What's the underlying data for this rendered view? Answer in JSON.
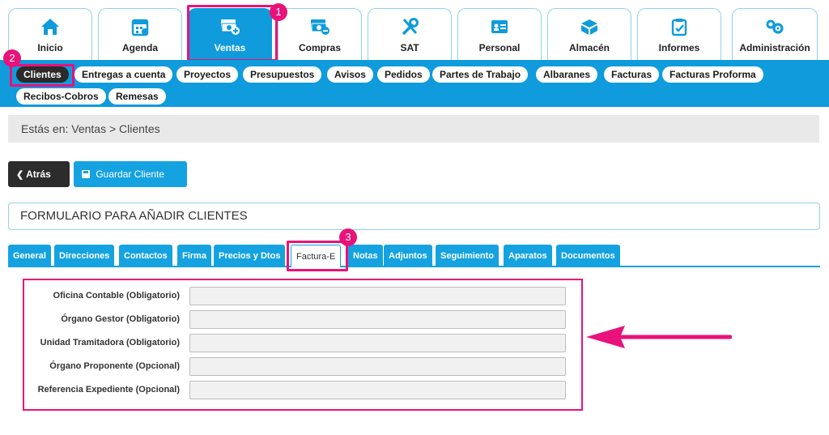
{
  "modules": [
    {
      "label": "Inicio",
      "icon": "home-icon"
    },
    {
      "label": "Agenda",
      "icon": "calendar-icon"
    },
    {
      "label": "Ventas",
      "icon": "money-plus-icon"
    },
    {
      "label": "Compras",
      "icon": "money-minus-icon"
    },
    {
      "label": "SAT",
      "icon": "tools-icon"
    },
    {
      "label": "Personal",
      "icon": "id-card-icon"
    },
    {
      "label": "Almacén",
      "icon": "boxes-icon"
    },
    {
      "label": "Informes",
      "icon": "clipboard-check-icon"
    },
    {
      "label": "Administración",
      "icon": "gears-icon"
    }
  ],
  "subnav": [
    "Clientes",
    "Entregas a cuenta",
    "Proyectos",
    "Presupuestos",
    "Avisos",
    "Pedidos",
    "Partes de Trabajo",
    "Albaranes",
    "Facturas",
    "Facturas Proforma",
    "Recibos-Cobros",
    "Remesas"
  ],
  "breadcrumb": "Estás en: Ventas > Clientes",
  "buttons": {
    "back": "Atrás",
    "save": "Guardar Cliente"
  },
  "form_title": "FORMULARIO PARA AÑADIR CLIENTES",
  "tabs": [
    "General",
    "Direcciones",
    "Contactos",
    "Firma",
    "Precios y Dtos",
    "Factura-E",
    "Notas",
    "Adjuntos",
    "Seguimiento",
    "Aparatos",
    "Documentos"
  ],
  "fields": [
    {
      "label": "Oficina Contable (Obligatorio)",
      "value": ""
    },
    {
      "label": "Órgano Gestor (Obligatorio)",
      "value": ""
    },
    {
      "label": "Unidad Tramitadora (Obligatorio)",
      "value": ""
    },
    {
      "label": "Órgano Proponente (Opcional)",
      "value": ""
    },
    {
      "label": "Referencia Expediente (Opcional)",
      "value": ""
    }
  ],
  "annotations": [
    "1",
    "2",
    "3"
  ],
  "colors": {
    "brand": "#0f9bdc",
    "highlight": "#e8127a",
    "dark": "#2c2c2c"
  }
}
